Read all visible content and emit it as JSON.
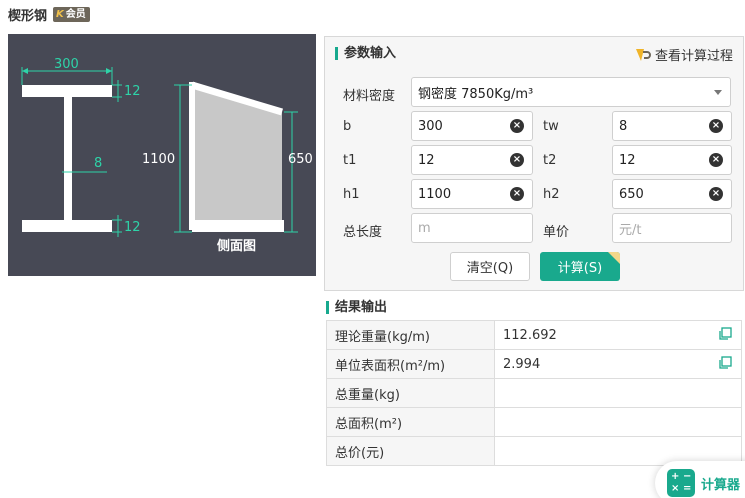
{
  "page": {
    "title": "楔形钢",
    "badge": "会员"
  },
  "diagram": {
    "width_label": "300",
    "flange_top_label": "12",
    "web_label": "8",
    "flange_bottom_label": "12",
    "h1_label": "1100",
    "h2_label": "650",
    "side_view_label": "侧面图"
  },
  "params": {
    "title": "参数输入",
    "view_process": "查看计算过程",
    "material_label": "材料密度",
    "material_value": "钢密度 7850Kg/m³",
    "b_label": "b",
    "b_value": "300",
    "tw_label": "tw",
    "tw_value": "8",
    "t1_label": "t1",
    "t1_value": "12",
    "t2_label": "t2",
    "t2_value": "12",
    "h1_label": "h1",
    "h1_value": "1100",
    "h2_label": "h2",
    "h2_value": "650",
    "length_label": "总长度",
    "length_placeholder": "m",
    "price_label": "单价",
    "price_placeholder": "元/t",
    "clear_button": "清空(Q)",
    "calc_button": "计算(S)"
  },
  "results": {
    "title": "结果输出",
    "rows": [
      {
        "label": "理论重量(kg/m)",
        "value": "112.692"
      },
      {
        "label": "单位表面积(m²/m)",
        "value": "2.994"
      },
      {
        "label": "总重量(kg)",
        "value": ""
      },
      {
        "label": "总面积(m²)",
        "value": ""
      },
      {
        "label": "总价(元)",
        "value": ""
      }
    ]
  },
  "widget": {
    "label": "计算器"
  },
  "colors": {
    "accent": "#19a98d",
    "diagram_bg": "#474955",
    "dimension": "#2ed3a8"
  }
}
